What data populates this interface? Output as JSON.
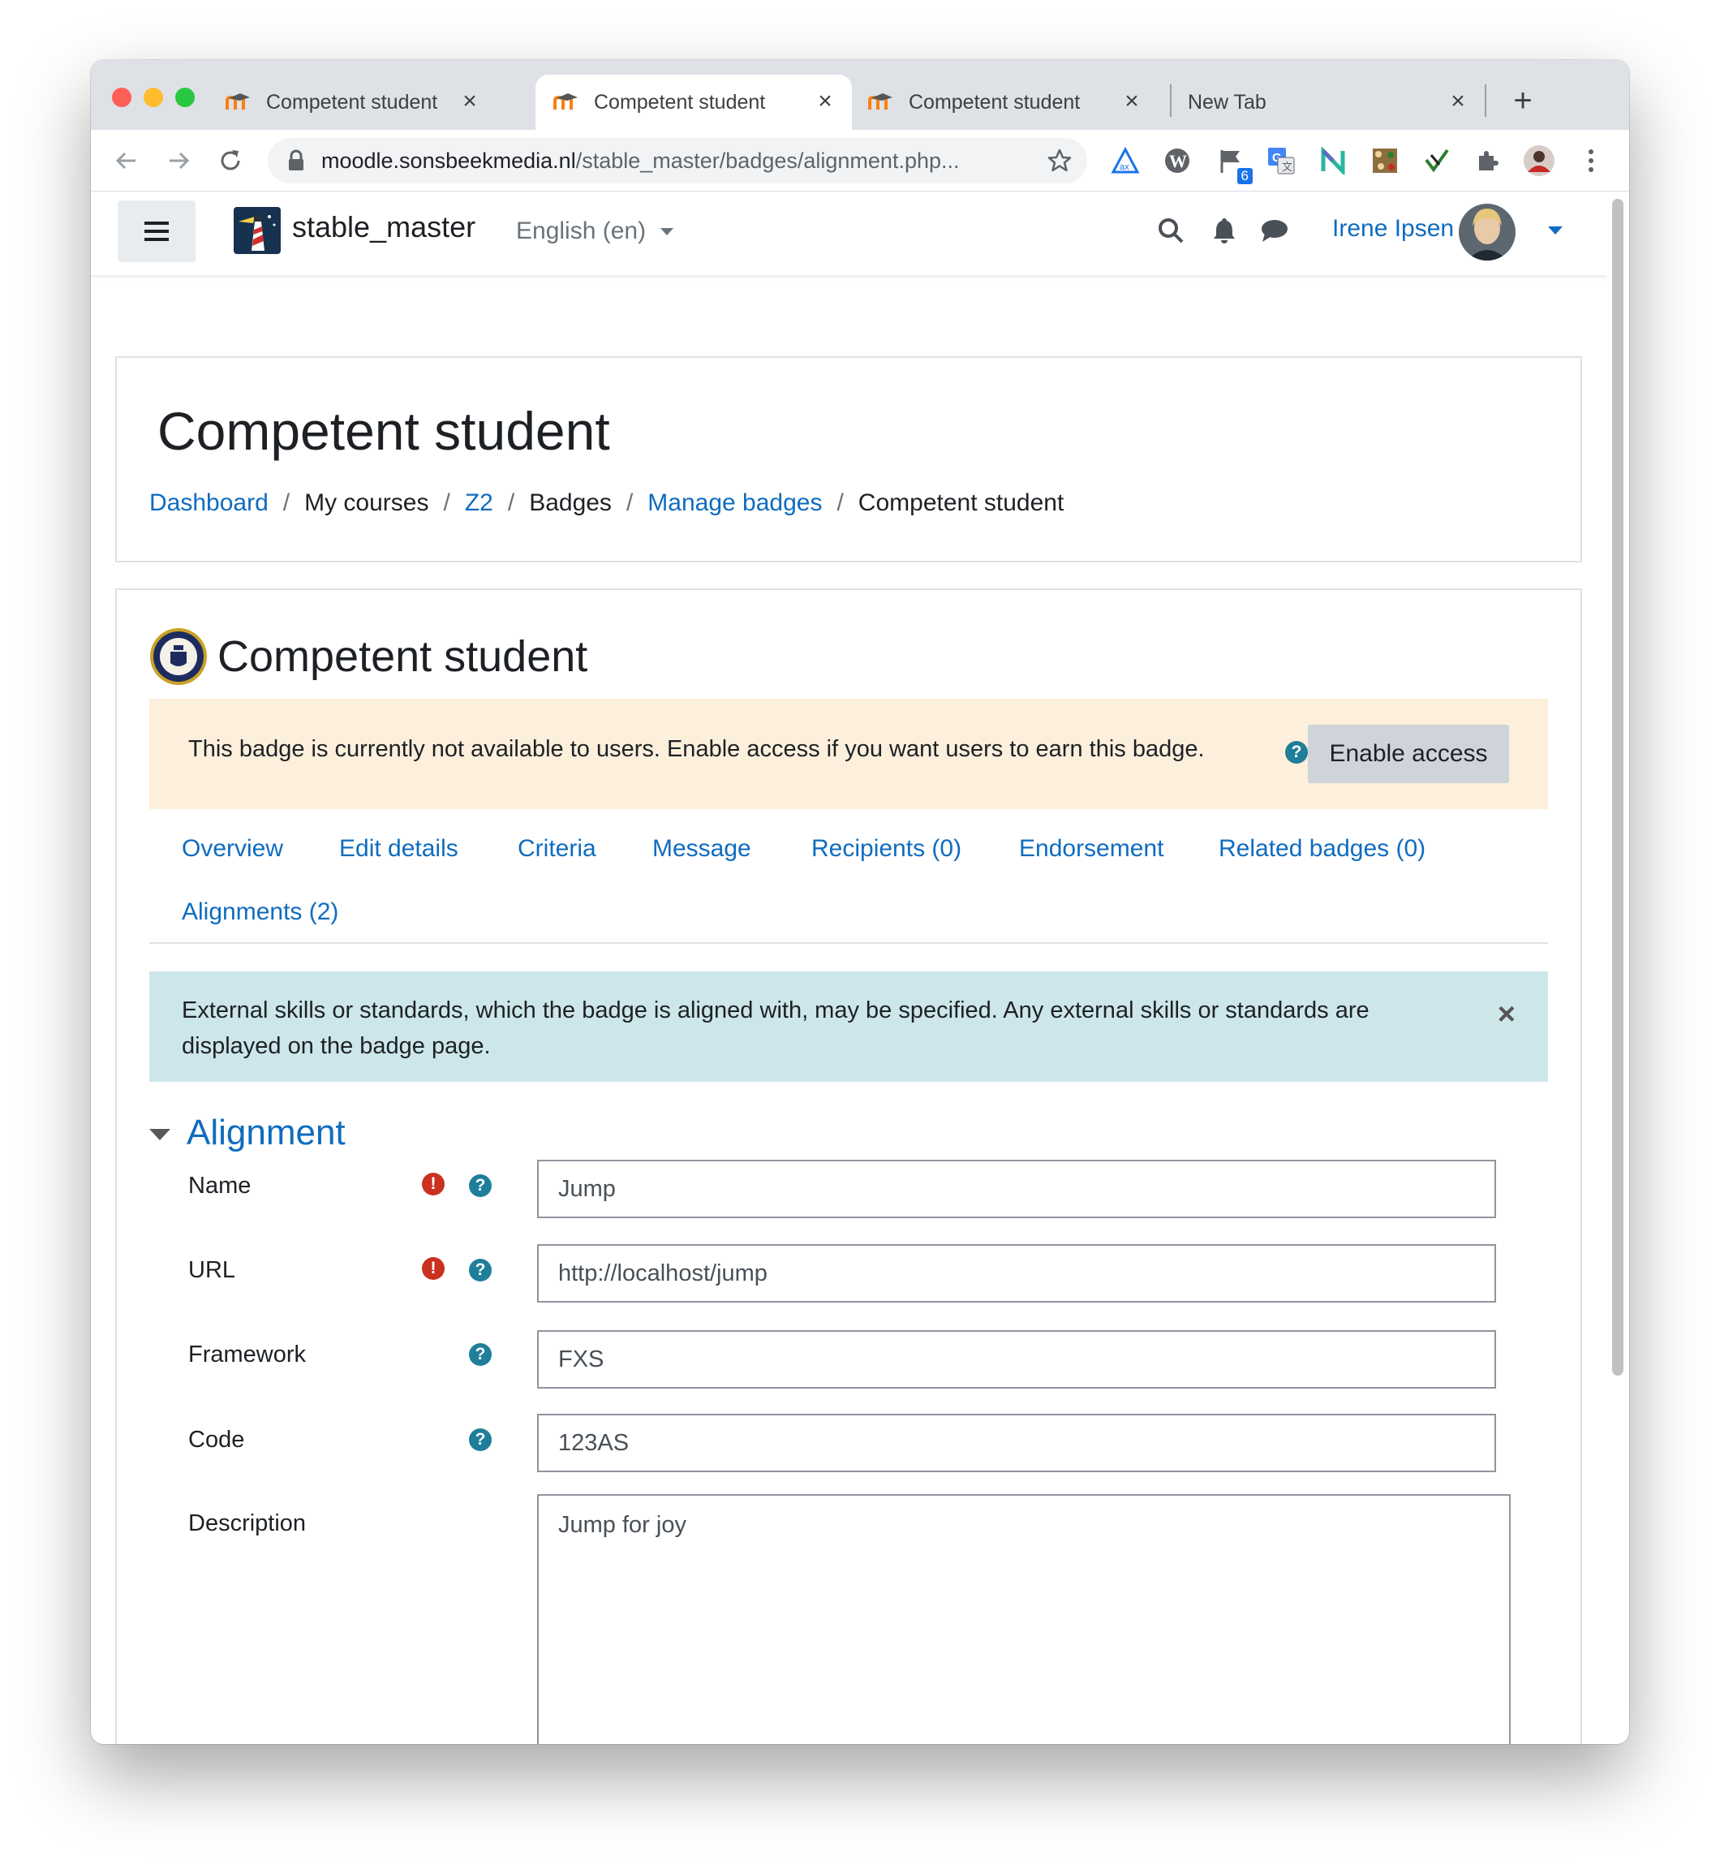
{
  "browser": {
    "tabs": [
      {
        "title": "Competent student",
        "active": false
      },
      {
        "title": "Competent student",
        "active": true
      },
      {
        "title": "Competent student",
        "active": false
      },
      {
        "title": "New Tab",
        "active": false
      }
    ],
    "close_glyph": "×",
    "new_tab_glyph": "+",
    "url_host": "moodle.sonsbeekmedia.nl",
    "url_path": "/stable_master/badges/alignment.php...",
    "extension_badge_count": "6",
    "icons": [
      "back-arrow-icon",
      "forward-arrow-icon",
      "reload-icon",
      "lock-icon",
      "star-icon",
      "extensions-puzzle-icon",
      "menu-kebab-icon"
    ]
  },
  "navbar": {
    "site_name": "stable_master",
    "language": "English (en)",
    "username": "Irene Ipsen",
    "icons": [
      "hamburger-icon",
      "search-icon",
      "bell-icon",
      "chat-icon"
    ]
  },
  "header": {
    "title": "Competent student",
    "breadcrumb": [
      {
        "label": "Dashboard",
        "link": true
      },
      {
        "label": "My courses",
        "link": false
      },
      {
        "label": "Z2",
        "link": true
      },
      {
        "label": "Badges",
        "link": false
      },
      {
        "label": "Manage badges",
        "link": true
      },
      {
        "label": "Competent student",
        "link": false
      }
    ],
    "separator": "/"
  },
  "badge": {
    "title": "Competent student",
    "warning": "This badge is currently not available to users. Enable access if you want users to earn this badge.",
    "enable_button": "Enable access",
    "tabs": [
      "Overview",
      "Edit details",
      "Criteria",
      "Message",
      "Recipients (0)",
      "Endorsement",
      "Related badges (0)",
      "Alignments (2)"
    ],
    "info": "External skills or standards, which the badge is aligned with, may be specified. Any external skills or standards are displayed on the badge page.",
    "info_close": "×"
  },
  "form": {
    "legend": "Alignment",
    "fields": {
      "name": {
        "label": "Name",
        "value": "Jump"
      },
      "url": {
        "label": "URL",
        "value": "http://localhost/jump"
      },
      "framework": {
        "label": "Framework",
        "value": "FXS"
      },
      "code": {
        "label": "Code",
        "value": "123AS"
      },
      "description": {
        "label": "Description",
        "value": "Jump for joy"
      }
    },
    "required_glyph": "!",
    "help_glyph": "?"
  },
  "colors": {
    "link": "#0f6cbf",
    "warning_bg": "#fcefdc",
    "info_bg": "#cce6ea",
    "required": "#ca3120",
    "help": "#1f7e9a"
  }
}
